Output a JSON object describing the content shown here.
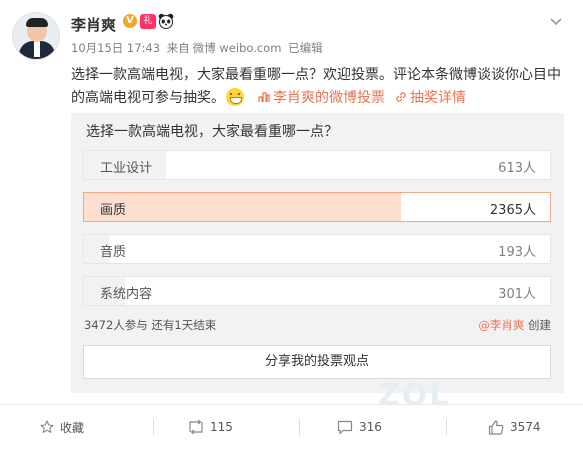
{
  "user": {
    "name": "李肖爽",
    "badge_v": "V",
    "badge_gift": "礼"
  },
  "meta": {
    "date": "10月15日 17:43",
    "source_prefix": "来自",
    "source": "微博 weibo.com",
    "edited": "已编辑"
  },
  "post": {
    "text": "选择一款高端电视，大家最看重哪一点？欢迎投票。评论本条微博谈谈你心目中的高端电视可参与抽奖。",
    "link1": "李肖爽的微博投票",
    "link2": "抽奖详情"
  },
  "poll": {
    "question": "选择一款高端电视，大家最看重哪一点？",
    "options": [
      {
        "label": "工业设计",
        "count": "613人",
        "fraction": 0.176
      },
      {
        "label": "画质",
        "count": "2365人",
        "fraction": 0.681
      },
      {
        "label": "音质",
        "count": "193人",
        "fraction": 0.056
      },
      {
        "label": "系统内容",
        "count": "301人",
        "fraction": 0.087
      }
    ],
    "stats": "3472人参与 还有1天结束",
    "creator_link": "@李肖爽",
    "creator_suffix": "创建",
    "share_label": "分享我的投票观点"
  },
  "watermark": "ZOL",
  "actions": {
    "favorite": "收藏",
    "repost": "115",
    "comment": "316",
    "like": "3574"
  },
  "colors": {
    "accent": "#eb7350",
    "selected_bar": "#fddfd0",
    "selected_border": "#f5a78c",
    "poll_bg": "#f2f2f5"
  }
}
